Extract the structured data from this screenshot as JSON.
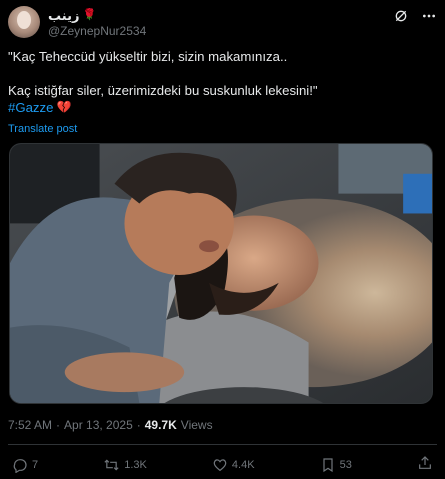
{
  "author": {
    "display_name": "زينب",
    "display_emoji": "🌹",
    "handle": "@ZeynepNur2534"
  },
  "icons": {
    "grok": "grok-icon",
    "more": "more-icon",
    "reply": "reply-icon",
    "retweet": "retweet-icon",
    "like": "like-icon",
    "bookmark": "bookmark-icon",
    "share": "share-icon"
  },
  "tweet": {
    "line1": "\"Kaç Teheccüd yükseltir bizi, sizin makamınıza..",
    "line2": "Kaç istiğfar siler, üzerimizdeki bu suskunluk lekesini!\"",
    "hashtag": "#Gazze",
    "hashtag_emoji": "💔",
    "translate_label": "Translate post"
  },
  "meta": {
    "time": "7:52 AM",
    "separator": "·",
    "date": "Apr 13, 2025",
    "separator2": "·",
    "views_count": "49.7K",
    "views_label": "Views"
  },
  "actions": {
    "replies": "7",
    "retweets": "1.3K",
    "likes": "4.4K",
    "bookmarks": "53"
  },
  "colors": {
    "background": "#000000",
    "text": "#e7e9ea",
    "muted": "#71767b",
    "accent": "#1d9bf0",
    "divider": "#2f3336"
  }
}
